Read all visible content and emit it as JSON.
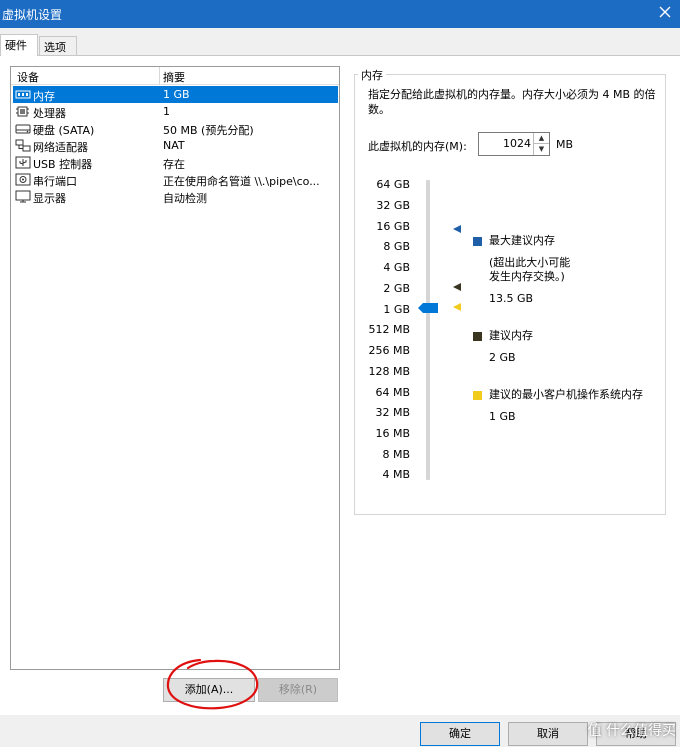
{
  "window": {
    "title": "虚拟机设置"
  },
  "tabs": [
    {
      "label": "硬件"
    },
    {
      "label": "选项"
    }
  ],
  "device_list": {
    "headers": {
      "device": "设备",
      "summary": "摘要"
    },
    "rows": [
      {
        "icon": "memory-icon",
        "name": "内存",
        "summary": "1 GB",
        "selected": true
      },
      {
        "icon": "processor-icon",
        "name": "处理器",
        "summary": "1"
      },
      {
        "icon": "hard-disk-icon",
        "name": "硬盘 (SATA)",
        "summary": "50 MB (预先分配)"
      },
      {
        "icon": "network-adapter-icon",
        "name": "网络适配器",
        "summary": "NAT"
      },
      {
        "icon": "usb-icon",
        "name": "USB 控制器",
        "summary": "存在"
      },
      {
        "icon": "serial-port-icon",
        "name": "串行端口",
        "summary": "正在使用命名管道 \\\\.\\pipe\\co..."
      },
      {
        "icon": "display-icon",
        "name": "显示器",
        "summary": "自动检测"
      }
    ]
  },
  "buttons": {
    "add": "添加(A)...",
    "remove": "移除(R)",
    "ok": "确定",
    "cancel": "取消",
    "help": "帮助"
  },
  "memory": {
    "group_title": "内存",
    "description": "指定分配给此虚拟机的内存量。内存大小必须为 4 MB 的倍数。",
    "field_label": "此虚拟机的内存(M):",
    "value": "1024",
    "unit": "MB",
    "ticks": [
      "64 GB",
      "32 GB",
      "16 GB",
      "8 GB",
      "4 GB",
      "2 GB",
      "1 GB",
      "512 MB",
      "256 MB",
      "128 MB",
      "64 MB",
      "32 MB",
      "16 MB",
      "8 MB",
      "4 MB"
    ],
    "slider_value": "1 GB",
    "legend": {
      "max_title": "最大建议内存",
      "max_note_1": "(超出此大小可能",
      "max_note_2": "发生内存交换。)",
      "max_value": "13.5 GB",
      "rec_title": "建议内存",
      "rec_value": "2 GB",
      "min_title": "建议的最小客户机操作系统内存",
      "min_value": "1 GB"
    },
    "colors": {
      "max": "#1f5fa8",
      "recommended": "#3a3520",
      "minimum": "#f2cc1c",
      "slider_thumb": "#0078d7"
    }
  },
  "watermark": "值 什么值得买"
}
